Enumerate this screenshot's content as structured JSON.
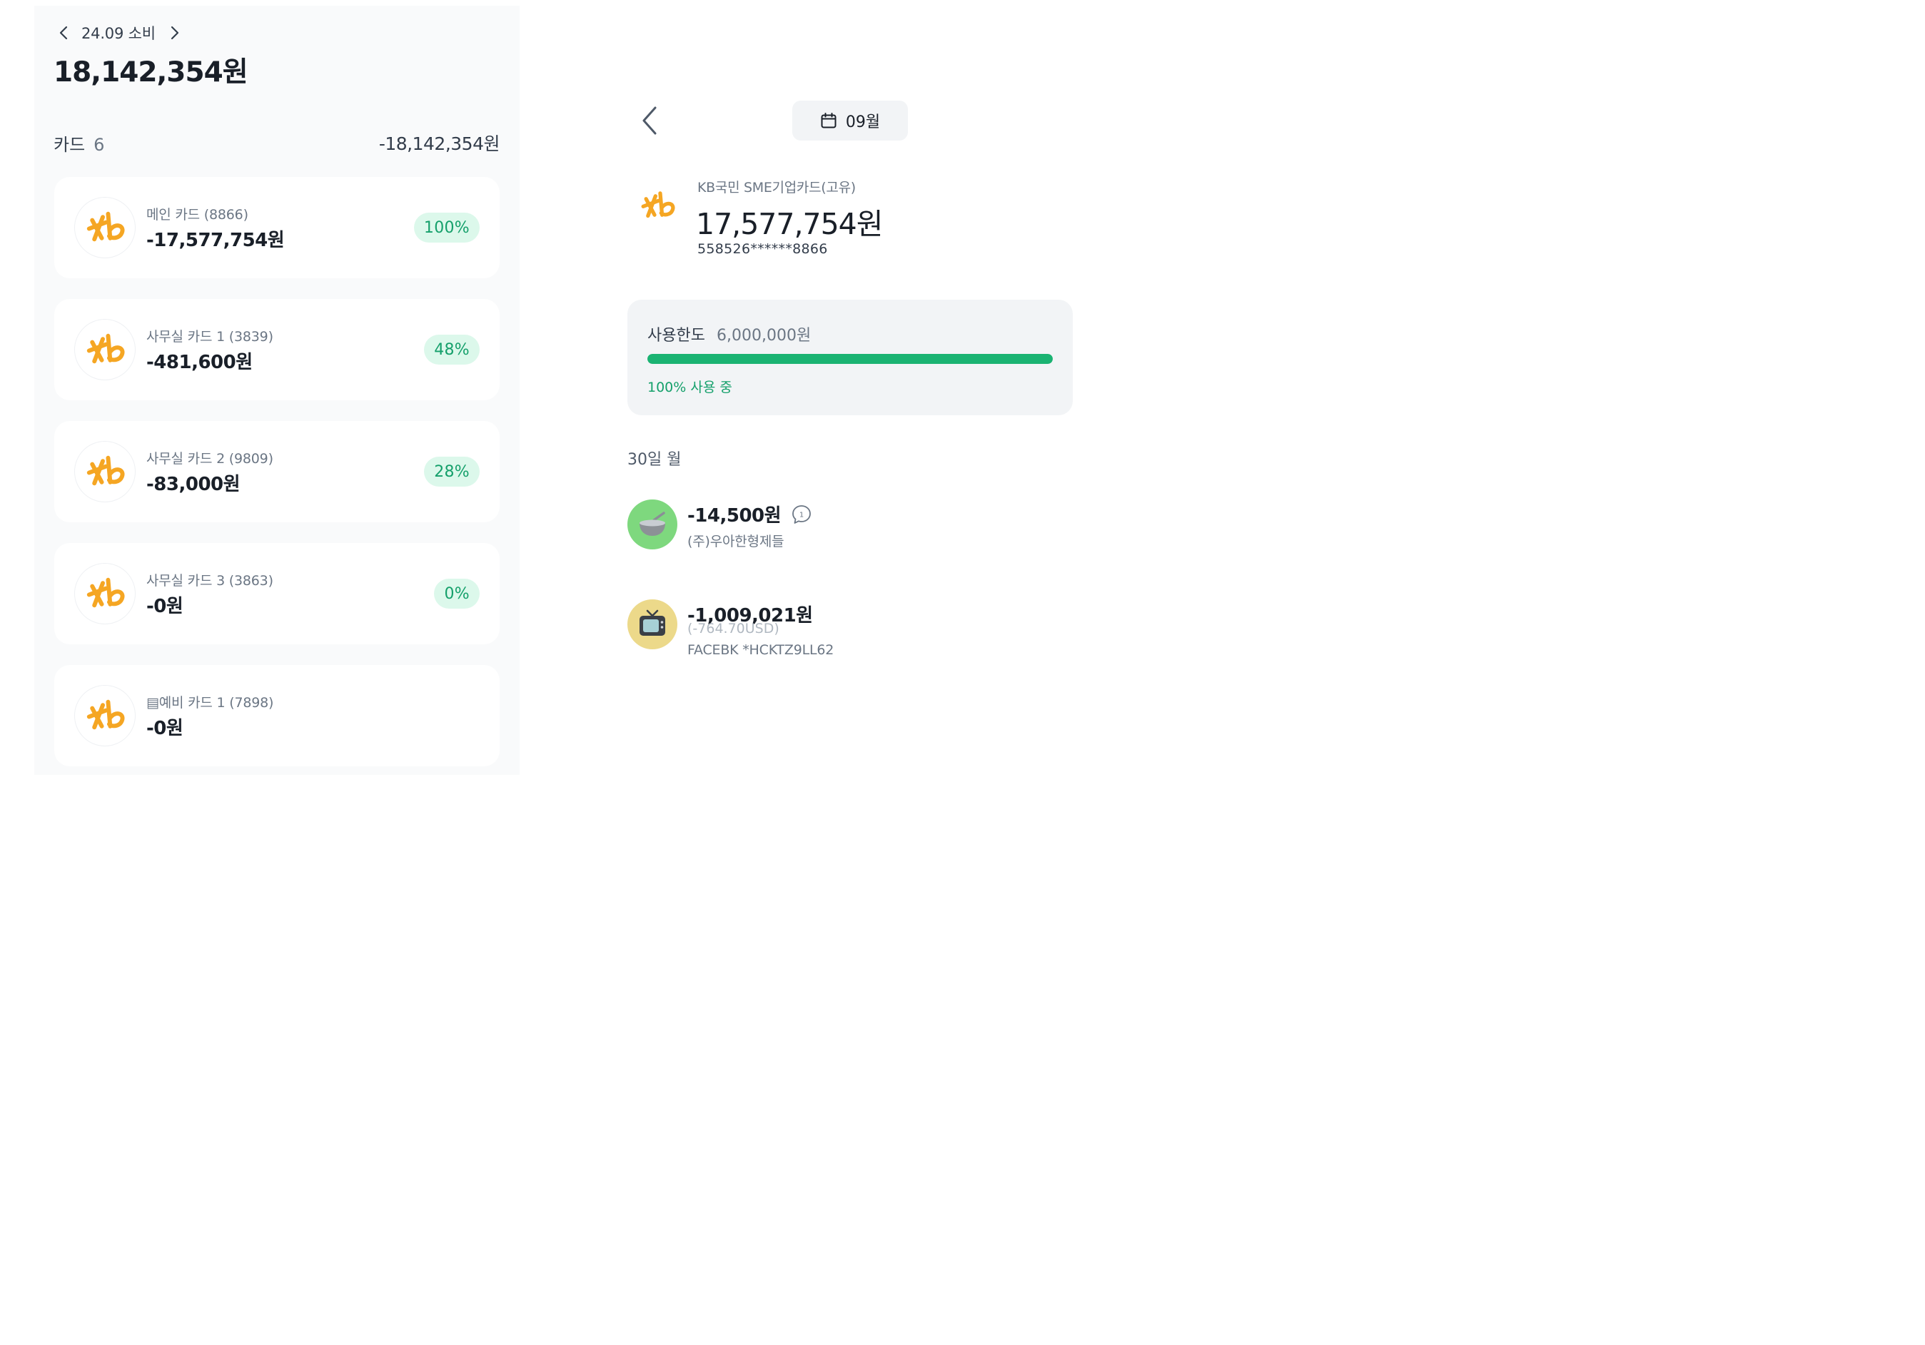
{
  "summary": {
    "month_label": "24.09 소비",
    "total_amount": "18,142,354원",
    "cards_label": "카드",
    "cards_count": "6",
    "cards_total": "-18,142,354원"
  },
  "cards": [
    {
      "name": "메인 카드 (8866)",
      "amount": "-17,577,754원",
      "percent": "100%"
    },
    {
      "name": "사무실 카드 1 (3839)",
      "amount": "-481,600원",
      "percent": "48%"
    },
    {
      "name": "사무실 카드 2 (9809)",
      "amount": "-83,000원",
      "percent": "28%"
    },
    {
      "name": "사무실 카드 3 (3863)",
      "amount": "-0원",
      "percent": "0%"
    },
    {
      "name": "▤예비 카드 1 (7898)",
      "amount": "-0원",
      "percent": ""
    }
  ],
  "detail": {
    "month_pill": "09월",
    "card_fullname": "KB국민 SME기업카드(고유)",
    "amount": "17,577,754원",
    "card_number": "558526******8866",
    "limit_label": "사용한도",
    "limit_value": "6,000,000원",
    "usage_fraction": 1.0,
    "usage_text": "100% 사용 중",
    "day_header": "30일 월"
  },
  "transactions": [
    {
      "amount": "-14,500원",
      "memo_count": "1",
      "merchant": "(주)우아한형제들",
      "icon": "food-bowl-icon",
      "icon_bg": "#7ed87e"
    },
    {
      "amount": "-1,009,021원",
      "foreign": "(-764.70USD)",
      "merchant": "FACEBK *HCKTZ9LL62",
      "icon": "tv-icon",
      "icon_bg": "#ecd98a"
    }
  ],
  "colors": {
    "accent_green": "#1ab372",
    "badge_bg": "#dcf8eb",
    "kb_yellow": "#f5a623"
  }
}
